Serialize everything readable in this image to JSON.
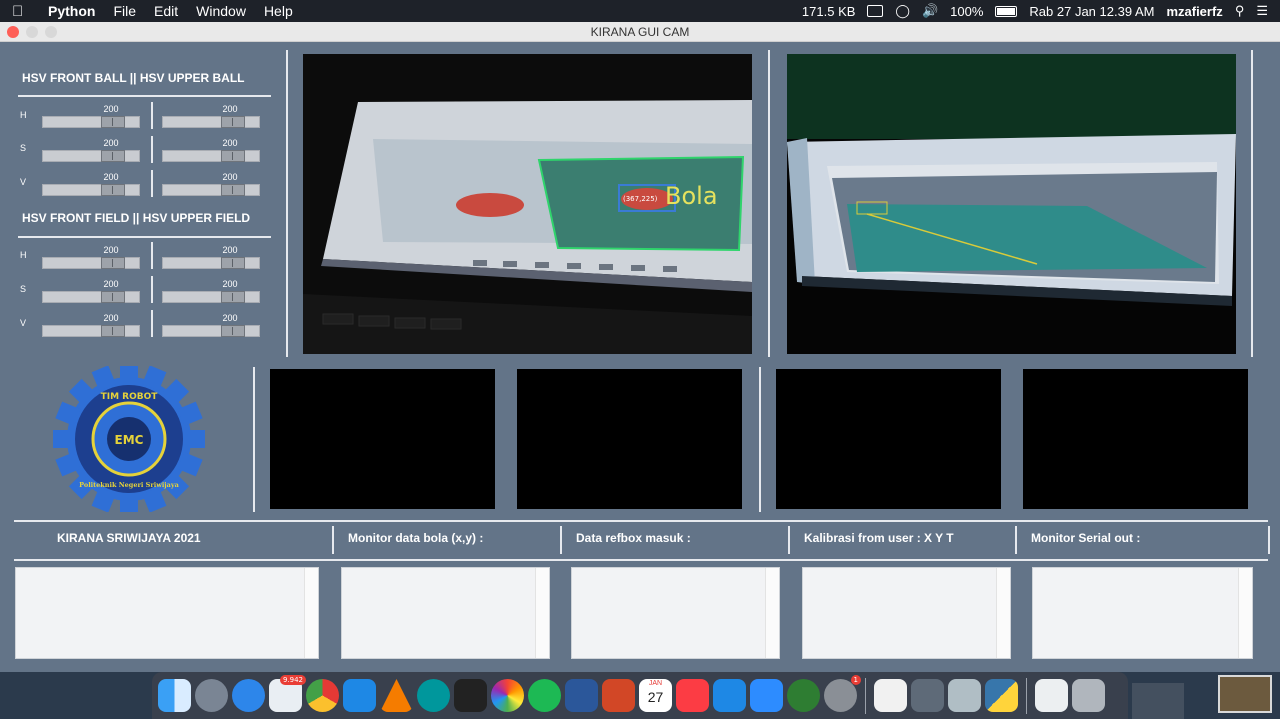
{
  "menubar": {
    "apple": "",
    "app": "Python",
    "menus": [
      "File",
      "Edit",
      "Window",
      "Help"
    ],
    "net_speed": "171.5 KB",
    "battery": "100%",
    "datetime": "Rab 27 Jan  12.39 AM",
    "user": "mzafierfz"
  },
  "window": {
    "title": "KIRANA GUI CAM"
  },
  "hsv": {
    "ball_title": "HSV FRONT BALL     ||   HSV UPPER BALL",
    "field_title": "HSV FRONT FIELD     ||  HSV UPPER FIELD",
    "channels": [
      "H",
      "S",
      "V"
    ],
    "ball_values": {
      "front": [
        "200",
        "200",
        "200"
      ],
      "upper": [
        "200",
        "200",
        "200"
      ]
    },
    "field_values": {
      "front": [
        "200",
        "200",
        "200"
      ],
      "upper": [
        "200",
        "200",
        "200"
      ]
    }
  },
  "cam1": {
    "overlay_text": "Bola",
    "bbox_label": "(367,225)"
  },
  "logo": {
    "top_text": "TIM ROBOT",
    "ring_text": "Politeknik Negeri Sriwijaya",
    "center_text": "EMC"
  },
  "status": {
    "team": "KIRANA SRIWIJAYA 2021",
    "ball_monitor": "Monitor data bola (x,y) :",
    "refbox": "Data refbox masuk :",
    "calibration": "Kalibrasi from user : X Y T",
    "serial": "Monitor Serial out :"
  },
  "dock": {
    "badges": {
      "mail": "9.942",
      "appstore": "1"
    },
    "calendar": {
      "month": "JAN",
      "day": "27"
    }
  }
}
